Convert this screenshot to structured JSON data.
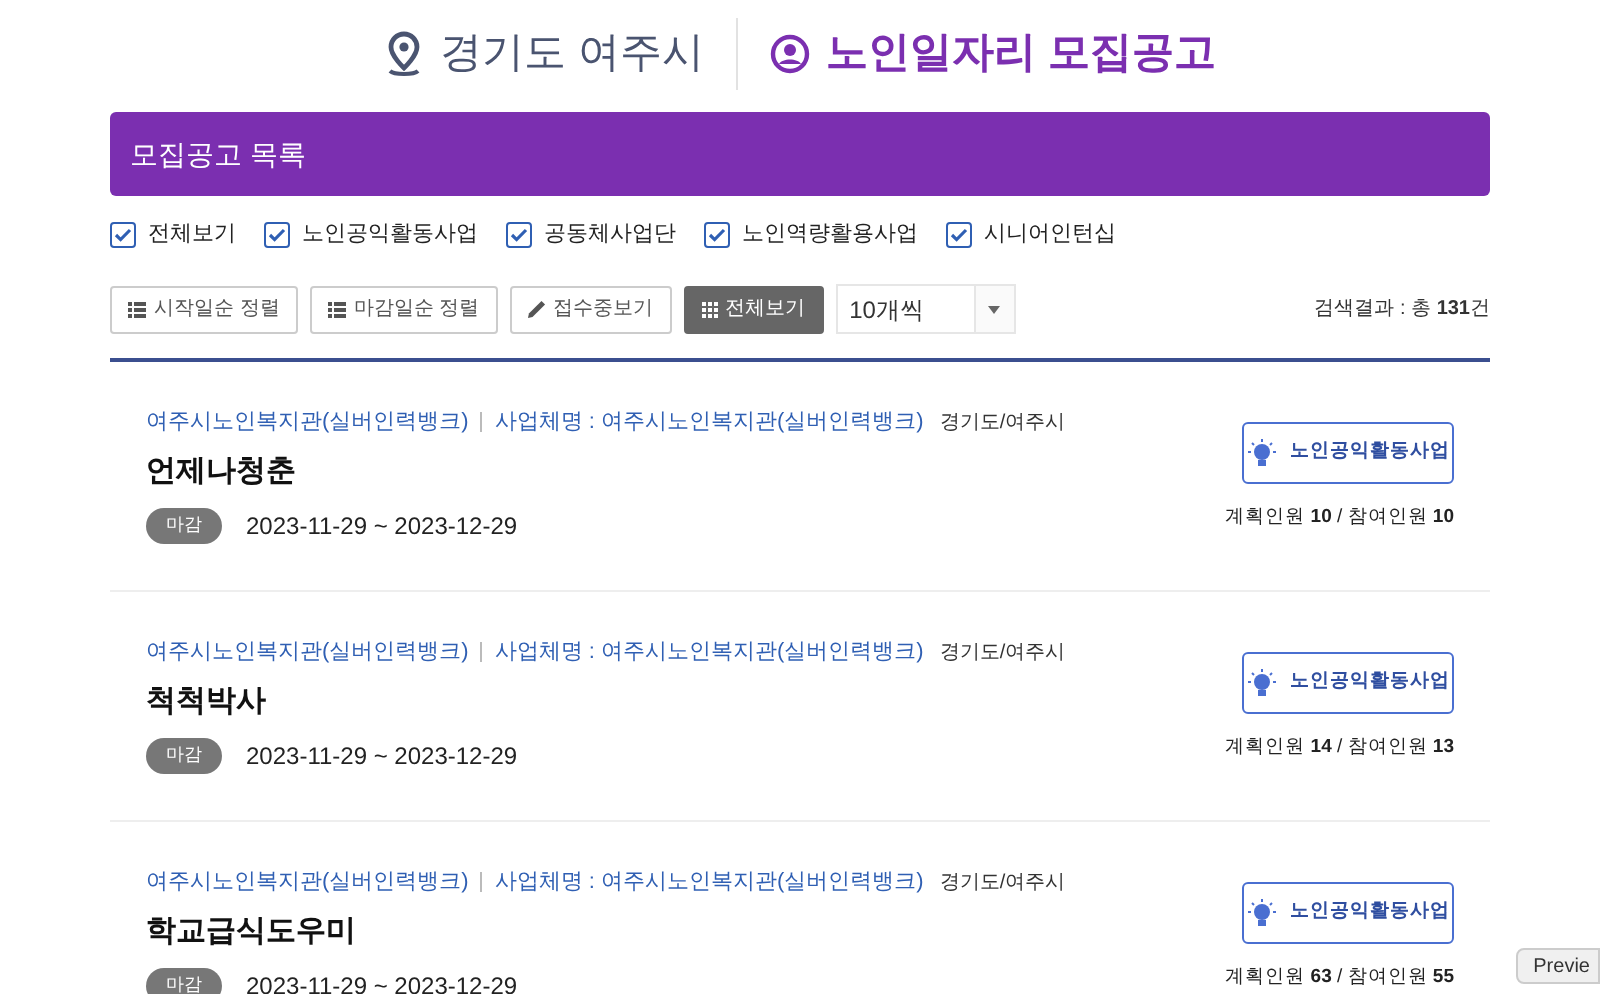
{
  "header": {
    "location": "경기도 여주시",
    "title": "노인일자리 모집공고"
  },
  "panel": {
    "title": "모집공고 목록"
  },
  "filters": [
    {
      "label": "전체보기",
      "checked": true
    },
    {
      "label": "노인공익활동사업",
      "checked": true
    },
    {
      "label": "공동체사업단",
      "checked": true
    },
    {
      "label": "노인역량활용사업",
      "checked": true
    },
    {
      "label": "시니어인턴십",
      "checked": true
    }
  ],
  "toolbar": {
    "buttons": [
      {
        "label": "시작일순 정렬",
        "kind": "list",
        "selected": false
      },
      {
        "label": "마감일순 정렬",
        "kind": "list",
        "selected": false
      },
      {
        "label": "접수중보기",
        "kind": "pencil",
        "selected": false
      },
      {
        "label": "전체보기",
        "kind": "grid",
        "selected": true
      }
    ],
    "page_size": "10개씩",
    "result_label": "검색결과 : 총 ",
    "result_count": "131",
    "result_unit": "건"
  },
  "postings": [
    {
      "org": "여주시노인복지관(실버인력뱅크)",
      "business": "사업체명 : 여주시노인복지관(실버인력뱅크)",
      "region": "경기도/여주시",
      "title": "언제나청춘",
      "status": "마감",
      "period": "2023-11-29 ~ 2023-12-29",
      "category": "노인공익활동사업",
      "planned_label": "계획인원 ",
      "planned": "10",
      "joined_label": " / 참여인원 ",
      "joined": "10"
    },
    {
      "org": "여주시노인복지관(실버인력뱅크)",
      "business": "사업체명 : 여주시노인복지관(실버인력뱅크)",
      "region": "경기도/여주시",
      "title": "척척박사",
      "status": "마감",
      "period": "2023-11-29 ~ 2023-12-29",
      "category": "노인공익활동사업",
      "planned_label": "계획인원 ",
      "planned": "14",
      "joined_label": " / 참여인원 ",
      "joined": "13"
    },
    {
      "org": "여주시노인복지관(실버인력뱅크)",
      "business": "사업체명 : 여주시노인복지관(실버인력뱅크)",
      "region": "경기도/여주시",
      "title": "학교급식도우미",
      "status": "마감",
      "period": "2023-11-29 ~ 2023-12-29",
      "category": "노인공익활동사업",
      "planned_label": "계획인원 ",
      "planned": "63",
      "joined_label": " / 참여인원 ",
      "joined": "55"
    }
  ],
  "tooltip": "Previe"
}
